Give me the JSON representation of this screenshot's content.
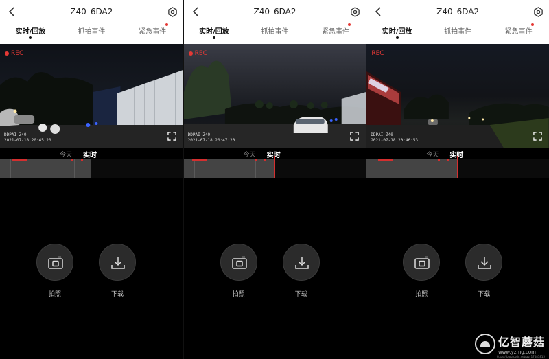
{
  "screens": [
    {
      "title": "Z40_6DA2",
      "tabs": [
        "实时/回放",
        "抓拍事件",
        "紧急事件"
      ],
      "rec_label": "REC",
      "brand": "DDPAI  Z40",
      "stamp_date": "2021-07-18",
      "stamp_time": "20:45:20",
      "today_label": "今天",
      "live_label": "实时",
      "photo_label": "拍照",
      "download_label": "下载"
    },
    {
      "title": "Z40_6DA2",
      "tabs": [
        "实时/回放",
        "抓拍事件",
        "紧急事件"
      ],
      "rec_label": "REC",
      "brand": "DDPAI  Z40",
      "stamp_date": "2021-07-18",
      "stamp_time": "20:47:20",
      "today_label": "今天",
      "live_label": "实时",
      "photo_label": "拍照",
      "download_label": "下载"
    },
    {
      "title": "Z40_6DA2",
      "tabs": [
        "实时/回放",
        "抓拍事件",
        "紧急事件"
      ],
      "rec_label": "REC",
      "brand": "DDPAI  Z40",
      "stamp_date": "2021-07-18",
      "stamp_time": "20:46:53",
      "today_label": "今天",
      "live_label": "实时",
      "photo_label": "拍照",
      "download_label": "下载"
    }
  ],
  "watermark": {
    "name": "亿智蘑菇",
    "url": "www.yzmg.com",
    "small": "https://blog.csdn.net/qq_17587815"
  },
  "colors": {
    "accent_red": "#e53935",
    "header_bg": "#ffffff",
    "page_bg": "#000000"
  },
  "icons": [
    "back-arrow-icon",
    "settings-icon",
    "fullscreen-icon",
    "camera-icon",
    "download-icon"
  ]
}
